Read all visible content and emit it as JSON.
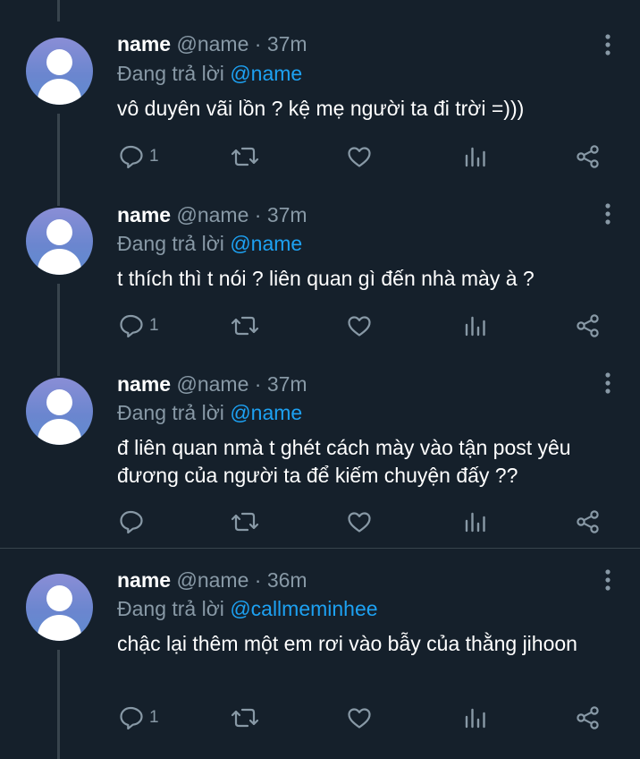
{
  "replying_label": "Đang trả lời",
  "tweets": [
    {
      "name": "name",
      "handle": "@name",
      "time": "· 37m",
      "reply_to": "@name",
      "text": "vô duyên vãi lồn ? kệ mẹ người ta đi trời =)))",
      "reply_count": "1"
    },
    {
      "name": "name",
      "handle": "@name",
      "time": "· 37m",
      "reply_to": "@name",
      "text": "t thích thì t nói ? liên quan gì đến nhà mày à ?",
      "reply_count": "1"
    },
    {
      "name": "name",
      "handle": "@name",
      "time": "· 37m",
      "reply_to": "@name",
      "text": "đ liên quan nmà t ghét cách mày vào tận post yêu đương của người ta để kiếm chuyện đấy ??",
      "reply_count": ""
    },
    {
      "name": "name",
      "handle": "@name",
      "time": "· 36m",
      "reply_to": "@callmeminhee",
      "text": "chậc lại thêm một em rơi vào bẫy của thằng jihoon",
      "reply_count": "1"
    }
  ],
  "icons": {
    "reply": "reply-icon",
    "retweet": "retweet-icon",
    "like": "heart-icon",
    "analytics": "analytics-icon",
    "share": "share-icon",
    "more": "more-vertical-icon"
  },
  "colors": {
    "background": "#15202b",
    "muted": "#8899a6",
    "accent": "#1da1f2",
    "line": "#38444d"
  }
}
